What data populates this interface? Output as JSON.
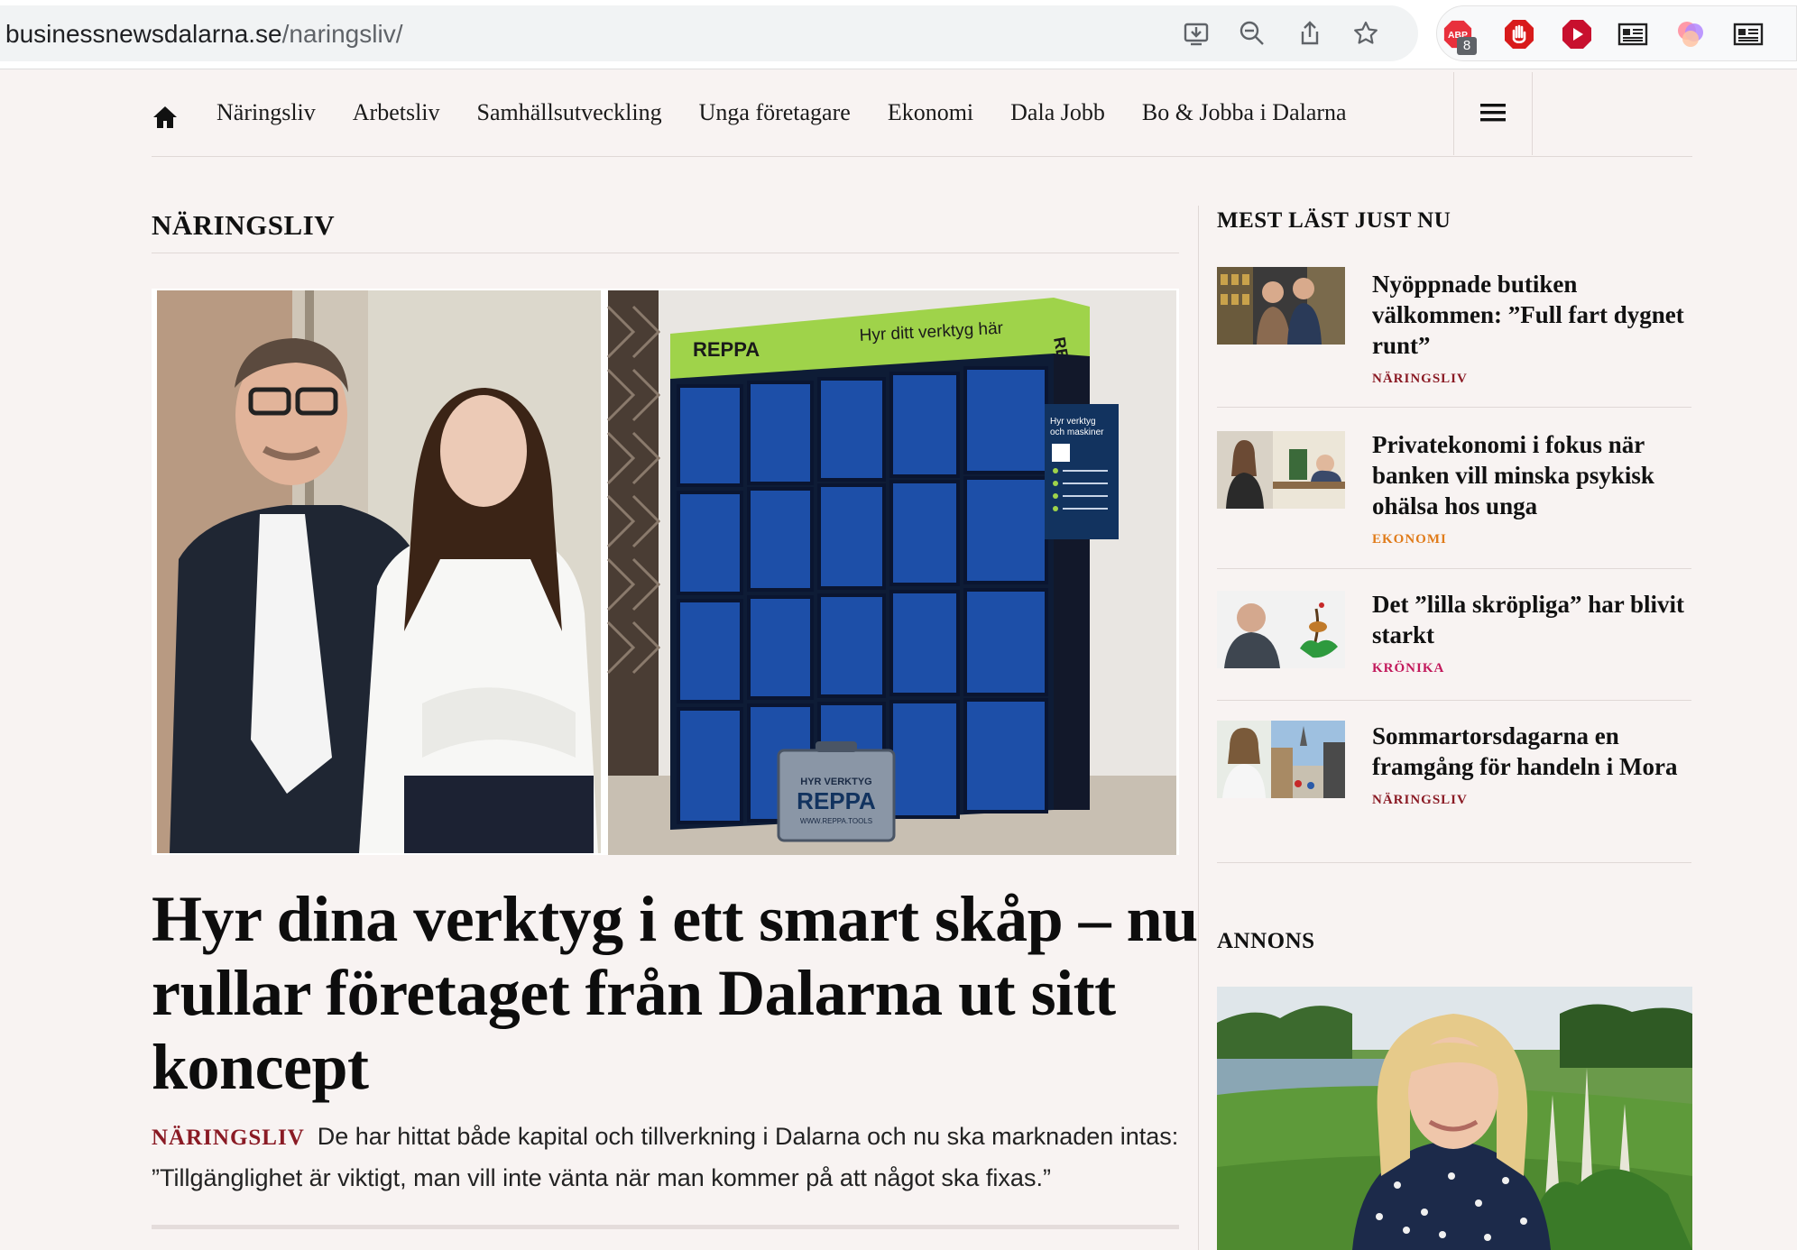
{
  "browser": {
    "url_host": "businessnewsdalarna.se",
    "url_path": "/naringsliv/",
    "abp_badge": "8",
    "abp_label": "ABP"
  },
  "nav": {
    "items": [
      "Näringsliv",
      "Arbetsliv",
      "Samhällsutveckling",
      "Unga företagare",
      "Ekonomi",
      "Dala Jobb",
      "Bo & Jobba i Dalarna"
    ]
  },
  "section_title": "NÄRINGSLIV",
  "hero": {
    "left_brand": "REPPA",
    "banner_text": "Hyr ditt verktyg här",
    "banner_right": "REPPA",
    "sign_line1": "Hyr verktyg",
    "sign_line2": "och maskiner",
    "case_line1": "HYR VERKTYG",
    "case_brand": "REPPA",
    "case_url": "WWW.REPPA.TOOLS"
  },
  "article": {
    "headline": "Hyr dina verktyg i ett smart skåp – nu rullar företaget från Dalarna ut sitt koncept",
    "category": "NÄRINGSLIV",
    "lead": "De har hittat både kapital och tillverkning i Dalarna och nu ska marknaden intas: ”Tillgänglighet är viktigt, man vill inte vänta när man kommer på att något ska fixas.”"
  },
  "sidebar": {
    "title": "MEST LÄST JUST NU",
    "items": [
      {
        "headline": "Nyöppnade butiken välkommen: ”Full fart dygnet runt”",
        "category": "NÄRINGSLIV",
        "color": "#8a1a24"
      },
      {
        "headline": "Privatekonomi i fokus när banken vill minska psykisk ohälsa hos unga",
        "category": "EKONOMI",
        "color": "#e07b1a"
      },
      {
        "headline": "Det ”lilla skröpliga” har blivit starkt",
        "category": "KRÖNIKA",
        "color": "#c2185b"
      },
      {
        "headline": "Sommartorsdagarna en framgång för handeln i Mora",
        "category": "NÄRINGSLIV",
        "color": "#8a1a24"
      }
    ],
    "ad_label": "ANNONS"
  }
}
